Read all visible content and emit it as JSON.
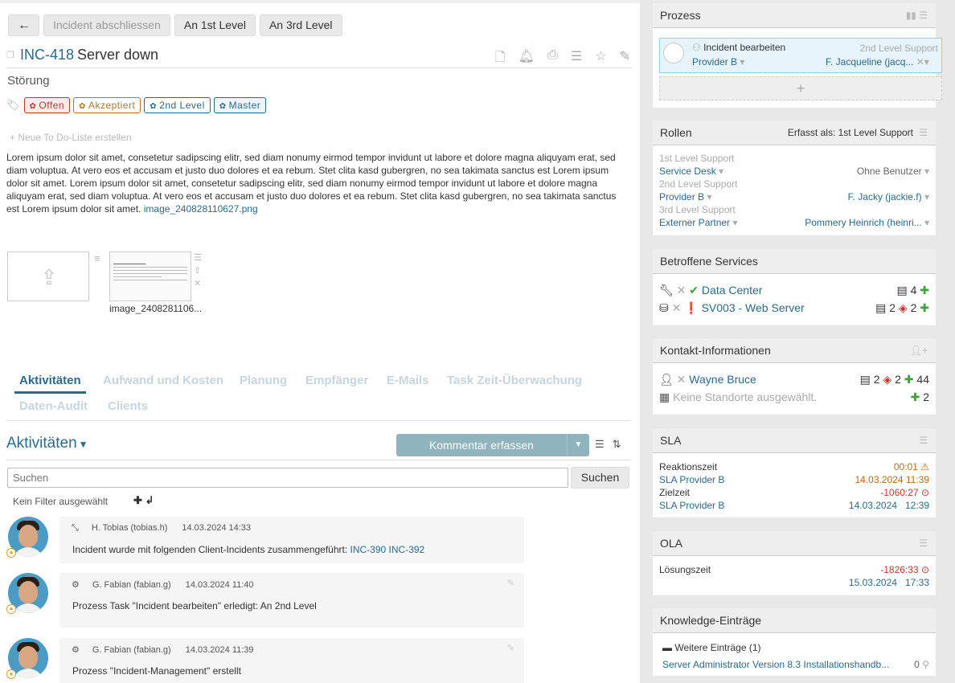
{
  "toolbar": {
    "back_icon": "←",
    "close_incident": "Incident abschliessen",
    "to_first_level": "An 1st Level",
    "to_third_level": "An 3rd Level"
  },
  "ticket": {
    "id": "INC-418",
    "title": "Server down",
    "category": "Störung",
    "tags": [
      {
        "label": "Offen",
        "color": "#c0392b",
        "bg": "#fbeaea"
      },
      {
        "label": "Akzeptiert",
        "color": "#b8752a",
        "bg": "#fff"
      },
      {
        "label": "2nd Level",
        "color": "#2a6a8c",
        "bg": "#fff"
      },
      {
        "label": "Master",
        "color": "#2a6a8c",
        "bg": "#eef5fb"
      }
    ],
    "todo_link": "Neue To Do-Liste erstellen",
    "description": "Lorem ipsum dolor sit amet, consetetur sadipscing elitr, sed diam nonumy eirmod tempor invidunt ut labore et dolore magna aliquyam erat, sed diam voluptua. At vero eos et accusam et justo duo dolores et ea rebum. Stet clita kasd gubergren, no sea takimata sanctus est Lorem ipsum dolor sit amet. Lorem ipsum dolor sit amet, consetetur sadipscing elitr, sed diam nonumy eirmod tempor invidunt ut labore et dolore magna aliquyam erat, sed diam voluptua. At vero eos et accusam et justo duo dolores et ea rebum. Stet clita kasd gubergren, no sea takimata sanctus est Lorem ipsum dolor sit amet.",
    "description_link": "image_240828110627.png",
    "attachment_name": "image_2408281106..."
  },
  "tabs": [
    "Aktivitäten",
    "Aufwand und Kosten",
    "Planung",
    "Empfänger",
    "E-Mails",
    "Task Zeit-Überwachung",
    "Daten-Audit",
    "Clients"
  ],
  "activities": {
    "header": "Aktivitäten",
    "comment_button": "Kommentar erfassen",
    "search_placeholder": "Suchen",
    "search_button": "Suchen",
    "no_filter": "Kein Filter ausgewählt",
    "items": [
      {
        "icon": "merge-icon",
        "user": "H. Tobias (tobias.h)",
        "time": "14.03.2024 14:33",
        "text": "Incident wurde mit folgenden Client-Incidents zusammengeführt: ",
        "links": "INC-390 INC-392"
      },
      {
        "icon": "gears-icon",
        "user": "G. Fabian (fabian.g)",
        "time": "14.03.2024 11:40",
        "text": "Prozess Task \"Incident bearbeiten\" erledigt: An 2nd Level",
        "links": ""
      },
      {
        "icon": "gears-icon",
        "user": "G. Fabian (fabian.g)",
        "time": "14.03.2024 11:39",
        "text": "Prozess \"Incident-Management\" erstellt",
        "links": ""
      }
    ]
  },
  "prozess": {
    "title": "Prozess",
    "task": "Incident bearbeiten",
    "level": "2nd Level Support",
    "provider": "Provider B",
    "assignee": "F. Jacqueline (jacq..."
  },
  "rollen": {
    "title": "Rollen",
    "captured_as": "Erfasst als: 1st Level Support",
    "rows": [
      {
        "label": "1st Level Support",
        "group": "Service Desk",
        "user": "Ohne Benutzer"
      },
      {
        "label": "2nd Level Support",
        "group": "Provider B",
        "user": "F. Jacky (jackie.f)"
      },
      {
        "label": "3rd Level Support",
        "group": "Externer Partner",
        "user": "Pommery Heinrich (heinri..."
      }
    ]
  },
  "services": {
    "title": "Betroffene Services",
    "items": [
      {
        "name": "Data Center",
        "count1": "4",
        "count2": ""
      },
      {
        "name": "SV003 - Web Server",
        "count1": "2",
        "count2": "2"
      }
    ]
  },
  "kontakt": {
    "title": "Kontakt-Informationen",
    "name": "Wayne Bruce",
    "c1": "2",
    "c2": "2",
    "c3": "44",
    "location": "Keine Standorte ausgewählt.",
    "c4": "2"
  },
  "sla": {
    "title": "SLA",
    "reaction_label": "Reaktionszeit",
    "reaction_value": "00:01",
    "provider1": "SLA Provider B",
    "date1": "14.03.2024 11:39",
    "target_label": "Zielzeit",
    "target_value": "-1060:27",
    "provider2": "SLA Provider B",
    "date2": "14.03.2024",
    "time2": "12:39"
  },
  "ola": {
    "title": "OLA",
    "label": "Lösungszeit",
    "value": "-1826:33",
    "date": "15.03.2024",
    "time": "17:33"
  },
  "knowledge": {
    "title": "Knowledge-Einträge",
    "more": "Weitere Einträge (1)",
    "entry": "Server Administrator Version 8.3 Installationshandb...",
    "count": "0"
  }
}
